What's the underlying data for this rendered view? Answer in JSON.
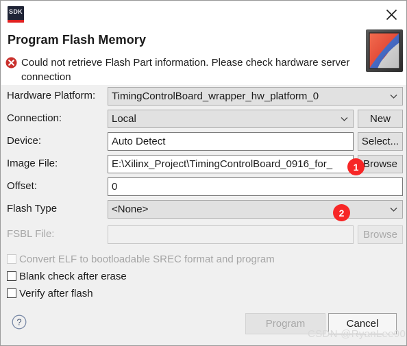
{
  "window": {
    "app_icon_text": "SDK",
    "close_label": "✕",
    "title": "Program Flash Memory",
    "error_message": "Could not retrieve Flash Part information. Please check hardware server connection"
  },
  "form": {
    "hardware_platform": {
      "label": "Hardware Platform:",
      "value": "TimingControlBoard_wrapper_hw_platform_0"
    },
    "connection": {
      "label": "Connection:",
      "value": "Local",
      "button": "New"
    },
    "device": {
      "label": "Device:",
      "value": "Auto Detect",
      "button": "Select..."
    },
    "image_file": {
      "label": "Image File:",
      "value": "E:\\Xilinx_Project\\TimingControlBoard_0916_for_",
      "button": "Browse"
    },
    "offset": {
      "label": "Offset:",
      "value": "0"
    },
    "flash_type": {
      "label": "Flash Type",
      "value": "<None>"
    },
    "fsbl_file": {
      "label": "FSBL File:",
      "value": "",
      "button": "Browse"
    }
  },
  "checkboxes": [
    {
      "label": "Convert ELF to bootloadable SREC format and program",
      "checked": false,
      "enabled": false
    },
    {
      "label": "Blank check after erase",
      "checked": false,
      "enabled": true
    },
    {
      "label": "Verify after flash",
      "checked": false,
      "enabled": true
    }
  ],
  "footer": {
    "help_label": "?",
    "program_label": "Program",
    "cancel_label": "Cancel"
  },
  "annotations": [
    {
      "number": "1"
    },
    {
      "number": "2"
    }
  ],
  "watermark": "CSDN @RyanLee90",
  "colors": {
    "accent_red": "#f72626",
    "error_red": "#c9302c",
    "body_bg": "#f0f0f0",
    "header_bg": "#ffffff"
  }
}
